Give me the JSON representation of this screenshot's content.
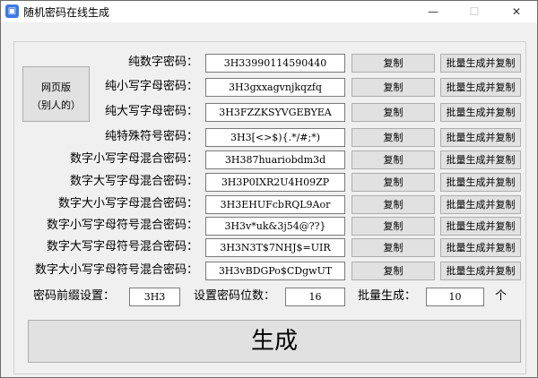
{
  "window": {
    "title": "随机密码在线生成",
    "minimize": "—",
    "maximize": "☐",
    "close": "✕"
  },
  "web_button": {
    "line1": "网页版",
    "line2": "（别人的）"
  },
  "rows": [
    {
      "label": "纯数字密码：",
      "value": "3H33990114590440"
    },
    {
      "label": "纯小写字母密码：",
      "value": "3H3gxxagvnjkqzfq"
    },
    {
      "label": "纯大写字母密码：",
      "value": "3H3FZZKSYVGEBYEA"
    },
    {
      "label": "纯特殊符号密码：",
      "value": "3H3[<>$){.*/#;*)"
    },
    {
      "label": "数字小写字母混合密码：",
      "value": "3H387huariobdm3d"
    },
    {
      "label": "数字大写字母混合密码：",
      "value": "3H3P0IXR2U4H09ZP"
    },
    {
      "label": "数字大小写字母混合密码：",
      "value": "3H3EHUFcbRQL9Aor"
    },
    {
      "label": "数字小写字母符号混合密码：",
      "value": "3H3v*uk&3j54@??}"
    },
    {
      "label": "数字大写字母符号混合密码：",
      "value": "3H3N3T$7NHJ$=UIR"
    },
    {
      "label": "数字大小写字母符号混合密码：",
      "value": "3H3vBDGPo$CDgwUT"
    }
  ],
  "copy_label": "复制",
  "batch_label": "批量生成并复制",
  "settings": {
    "prefix_label": "密码前缀设置：",
    "prefix": "3H3",
    "length_label": "设置密码位数：",
    "length": "16",
    "batch_label": "批量生成：",
    "batch_count": "10",
    "unit": "个"
  },
  "generate_label": "生成"
}
